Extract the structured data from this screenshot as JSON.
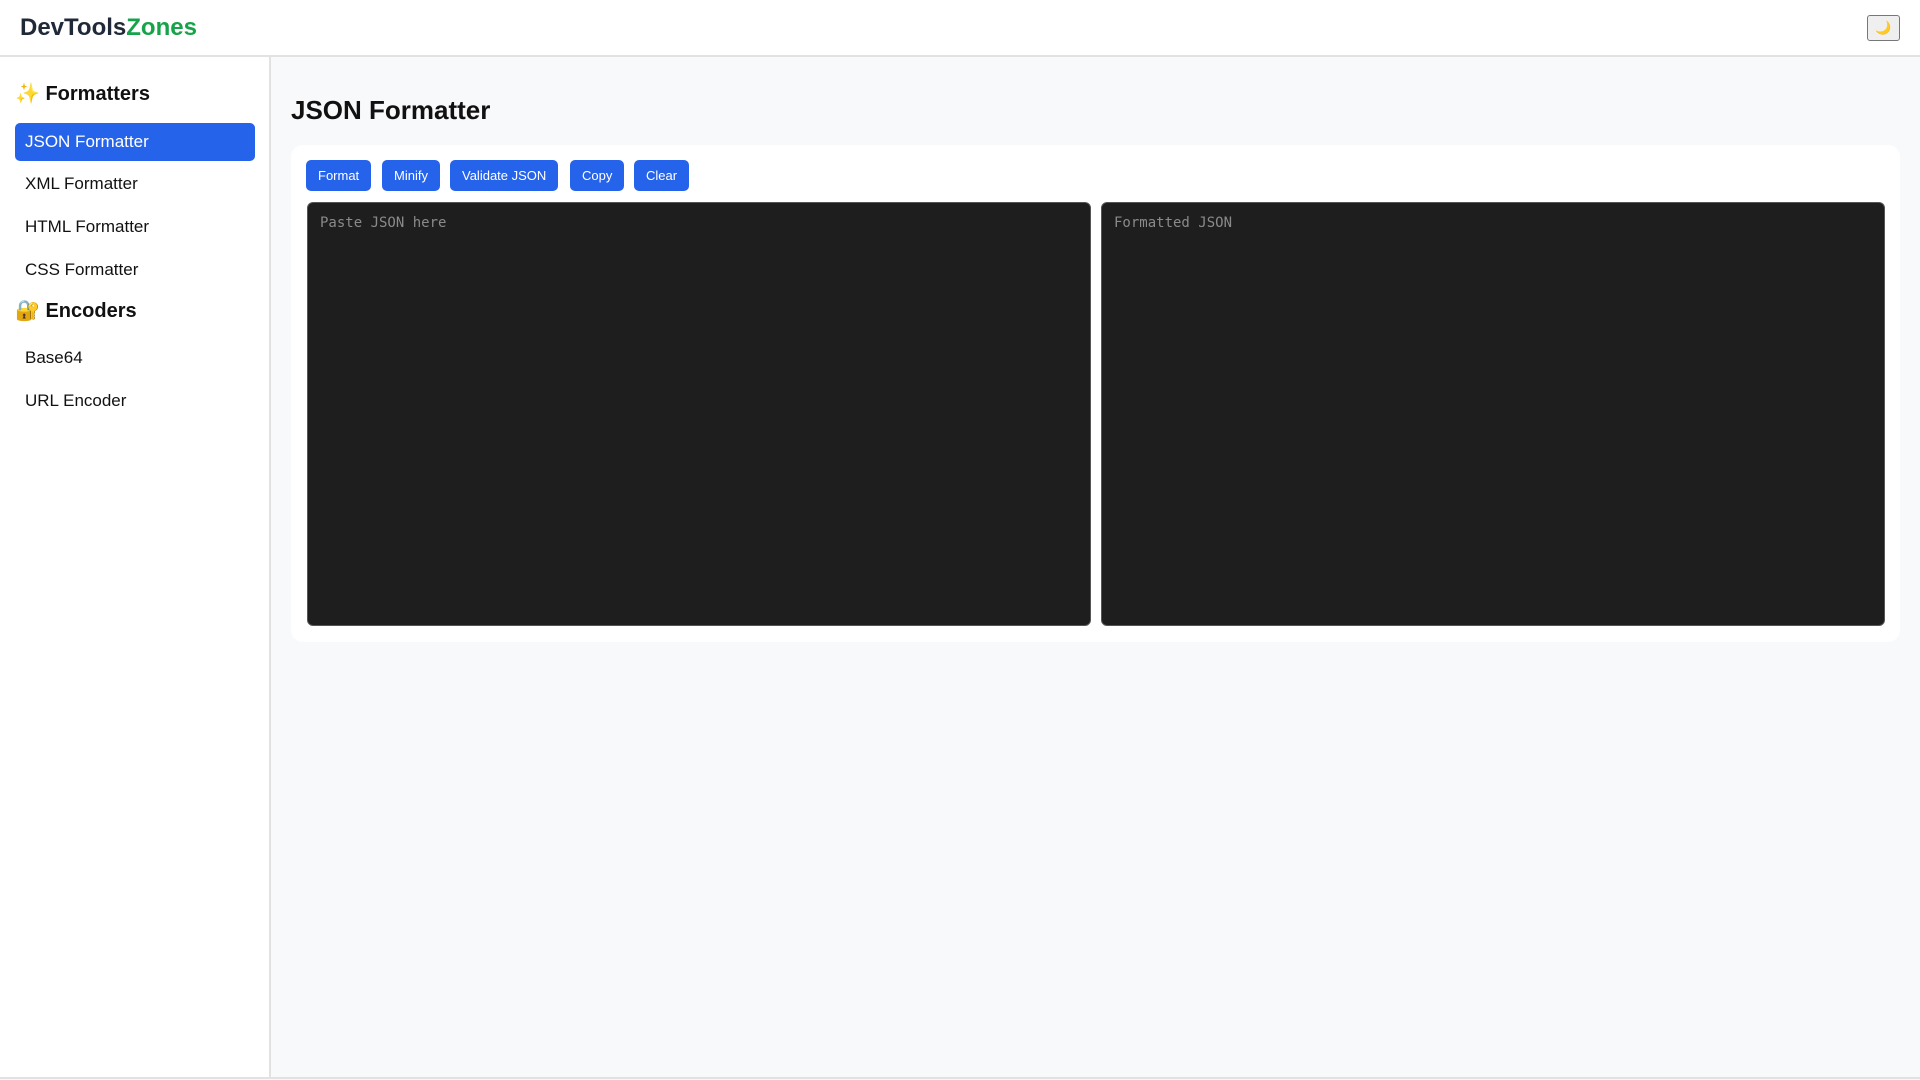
{
  "header": {
    "logo_part1": "DevTools",
    "logo_part2": "Zones",
    "theme_icon": "🌙"
  },
  "sidebar": {
    "sections": [
      {
        "icon": "✨",
        "title": "Formatters",
        "items": [
          {
            "label": "JSON Formatter",
            "active": true
          },
          {
            "label": "XML Formatter"
          },
          {
            "label": "HTML Formatter"
          },
          {
            "label": "CSS Formatter"
          }
        ]
      },
      {
        "icon": "🔐",
        "title": "Encoders",
        "items": [
          {
            "label": "Base64"
          },
          {
            "label": "URL Encoder"
          }
        ]
      }
    ]
  },
  "main": {
    "title": "JSON Formatter",
    "buttons": {
      "format": "Format",
      "minify": "Minify",
      "validate": "Validate JSON",
      "copy": "Copy",
      "clear": "Clear"
    },
    "input": {
      "value": "",
      "placeholder": "Paste JSON here"
    },
    "output": {
      "value": "",
      "placeholder": "Formatted JSON"
    }
  },
  "colors": {
    "accent": "#2563eb",
    "brand_green": "#16a34a",
    "editor_bg": "#1e1e1e"
  }
}
